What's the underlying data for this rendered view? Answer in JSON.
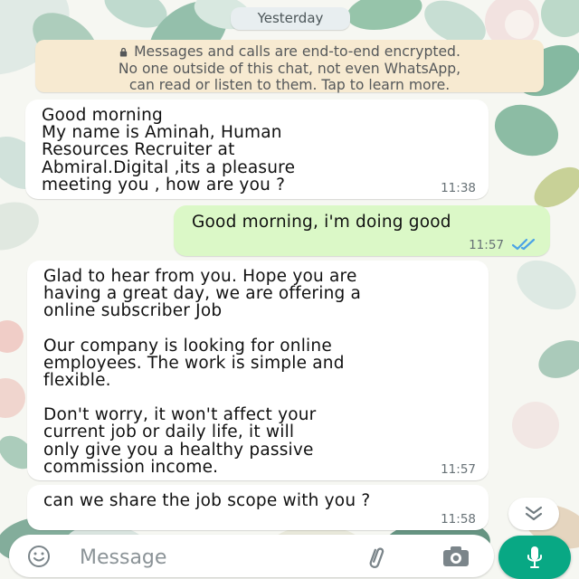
{
  "chat": {
    "date_label": "Yesterday",
    "encryption_notice": {
      "lines": [
        "Messages and calls are end-to-end encrypted.",
        "No one outside of this chat, not even WhatsApp,",
        "can read or listen to them. Tap to learn more."
      ],
      "icon": "lock-icon"
    },
    "messages": [
      {
        "direction": "incoming",
        "lines": [
          "Good morning",
          "My name is Aminah, Human",
          "Resources Recruiter at",
          "Abmiral.Digital ,its a pleasure",
          "meeting you , how are you ?"
        ],
        "time": "11:38"
      },
      {
        "direction": "outgoing",
        "lines": [
          "Good morning, i'm doing good"
        ],
        "time": "11:57",
        "status_icon": "double-check-read-icon"
      },
      {
        "direction": "incoming",
        "lines": [
          "Glad to hear from you. Hope you are",
          "having a great day, we are offering a",
          "online subscriber Job",
          "",
          "Our company is looking for online",
          "employees. The work is simple and",
          "flexible.",
          "",
          "Don't worry, it won't affect your",
          "current job or daily life, it will",
          "only give you a healthy passive",
          "commission income."
        ],
        "time": "11:57"
      },
      {
        "direction": "incoming",
        "lines": [
          "can we share the job scope with you ?"
        ],
        "time": "11:58"
      }
    ]
  },
  "composer": {
    "placeholder": "Message",
    "emoji_icon": "emoji-icon",
    "attach_icon": "paperclip-icon",
    "camera_icon": "camera-icon",
    "mic_icon": "microphone-icon",
    "scroll_icon": "double-chevron-down-icon"
  },
  "colors": {
    "incoming_bubble": "#ffffff",
    "outgoing_bubble": "#dbf8c7",
    "notice_bubble": "#f7ead1",
    "mic_button": "#08a884",
    "read_ticks": "#4ba3e6"
  }
}
